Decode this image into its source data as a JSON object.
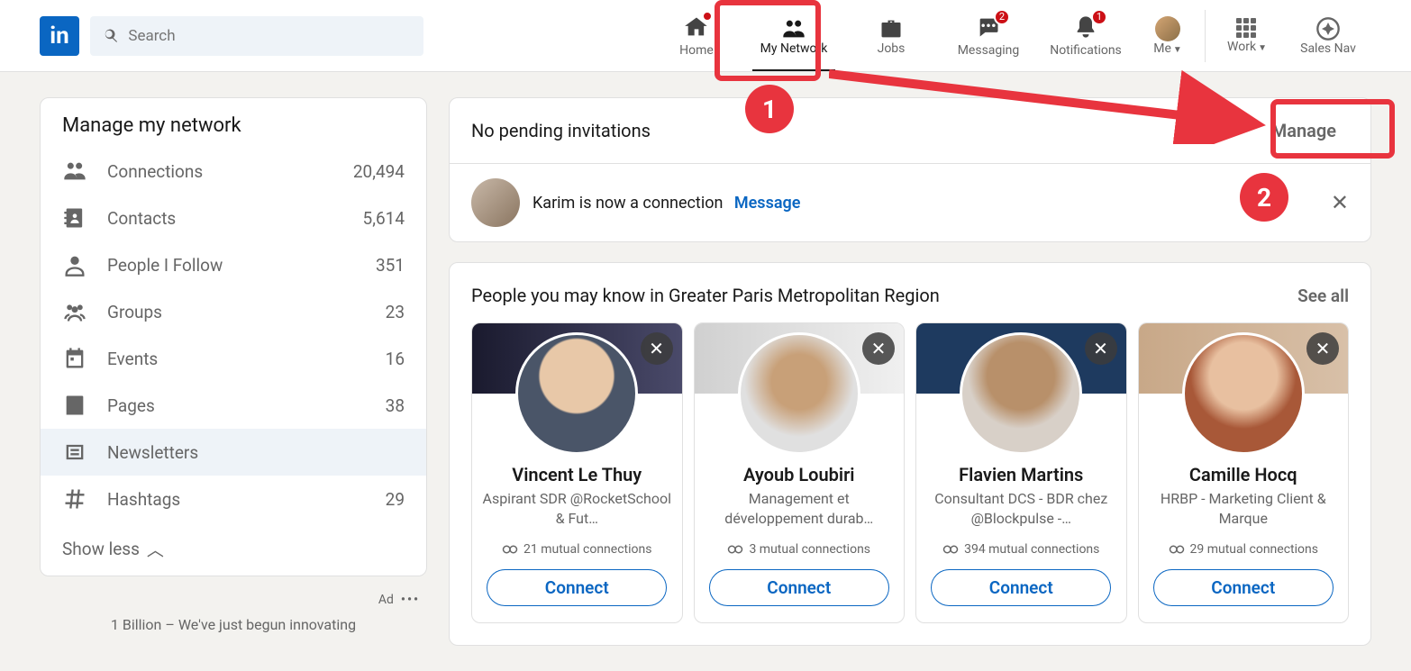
{
  "search": {
    "placeholder": "Search"
  },
  "nav": {
    "home": "Home",
    "my_network": "My Network",
    "jobs": "Jobs",
    "messaging": "Messaging",
    "messaging_badge": "2",
    "notifications": "Notifications",
    "notifications_badge": "1",
    "me": "Me",
    "work": "Work",
    "sales_nav": "Sales Nav"
  },
  "sidebar": {
    "title": "Manage my network",
    "items": [
      {
        "label": "Connections",
        "count": "20,494"
      },
      {
        "label": "Contacts",
        "count": "5,614"
      },
      {
        "label": "People I Follow",
        "count": "351"
      },
      {
        "label": "Groups",
        "count": "23"
      },
      {
        "label": "Events",
        "count": "16"
      },
      {
        "label": "Pages",
        "count": "38"
      },
      {
        "label": "Newsletters",
        "count": ""
      },
      {
        "label": "Hashtags",
        "count": "29"
      }
    ],
    "show_less": "Show less",
    "ad_label": "Ad",
    "ad_text": "1 Billion – We've just begun innovating"
  },
  "invitations": {
    "title": "No pending invitations",
    "manage": "Manage",
    "connection_text": "Karim is now a connection",
    "message": "Message"
  },
  "pymk": {
    "title": "People you may know in Greater Paris Metropolitan Region",
    "see_all": "See all",
    "connect": "Connect",
    "people": [
      {
        "name": "Vincent Le Thuy",
        "desc": "Aspirant SDR @RocketSchool & Fut…",
        "mutual": "21 mutual connections"
      },
      {
        "name": "Ayoub Loubiri",
        "desc": "Management et développement durab…",
        "mutual": "3 mutual connections"
      },
      {
        "name": "Flavien Martins",
        "desc": "Consultant DCS - BDR chez @Blockpulse -…",
        "mutual": "394 mutual connections"
      },
      {
        "name": "Camille Hocq",
        "desc": "HRBP - Marketing Client & Marque",
        "mutual": "29 mutual connections"
      }
    ]
  },
  "annotations": {
    "step1": "1",
    "step2": "2"
  }
}
